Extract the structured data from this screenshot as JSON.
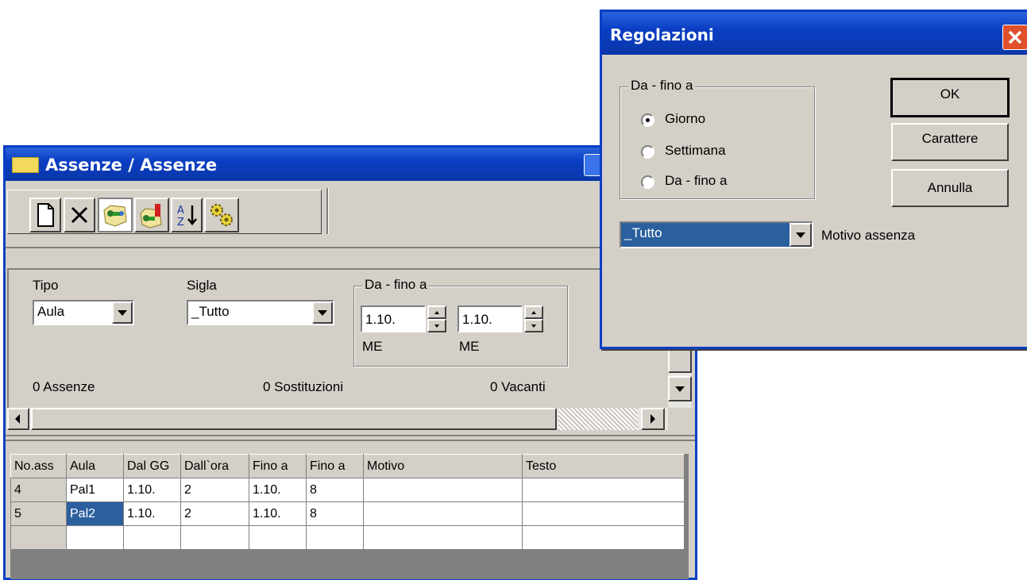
{
  "main_window": {
    "title": "Assenze / Assenze",
    "toolbar": [
      {
        "icon": "new-document-icon"
      },
      {
        "icon": "delete-x-icon"
      },
      {
        "icon": "absence-teacher-icon"
      },
      {
        "icon": "absence-room-icon"
      },
      {
        "icon": "sort-az-icon"
      },
      {
        "icon": "settings-gears-icon"
      }
    ],
    "filters": {
      "tipo_label": "Tipo",
      "tipo_value": "Aula",
      "sigla_label": "Sigla",
      "sigla_value": "_Tutto",
      "range_label": "Da - fino a",
      "from_value": "1.10.",
      "to_value": "1.10.",
      "from_day": "ME",
      "to_day": "ME"
    },
    "counts": {
      "absences": "0 Assenze",
      "substitutions": "0 Sostituzioni",
      "vacancies": "0 Vacanti"
    },
    "table": {
      "headers": [
        "No.ass",
        "Aula",
        "Dal GG",
        "Dall`ora",
        "Fino a",
        "Fino a",
        "Motivo",
        "Testo"
      ],
      "rows": [
        [
          "4",
          "Pal1",
          "1.10.",
          "2",
          "1.10.",
          "8",
          "",
          ""
        ],
        [
          "5",
          "Pal2",
          "1.10.",
          "2",
          "1.10.",
          "8",
          "",
          ""
        ],
        [
          "",
          "",
          "",
          "",
          "",
          "",
          "",
          ""
        ]
      ]
    }
  },
  "dialog": {
    "title": "Regolazioni",
    "group_label": "Da - fino a",
    "radios": [
      {
        "label": "Giorno",
        "checked": true
      },
      {
        "label": "Settimana",
        "checked": false
      },
      {
        "label": "Da - fino a",
        "checked": false
      }
    ],
    "buttons": {
      "ok": "OK",
      "font": "Carattere",
      "cancel": "Annulla"
    },
    "combo_value": "_Tutto",
    "combo_label": "Motivo assenza"
  },
  "colors": {
    "title_bar": "#0a3fc4",
    "window_bg": "#d4d0c8",
    "selection": "#2b5f9e",
    "close_button": "#e0502c"
  }
}
